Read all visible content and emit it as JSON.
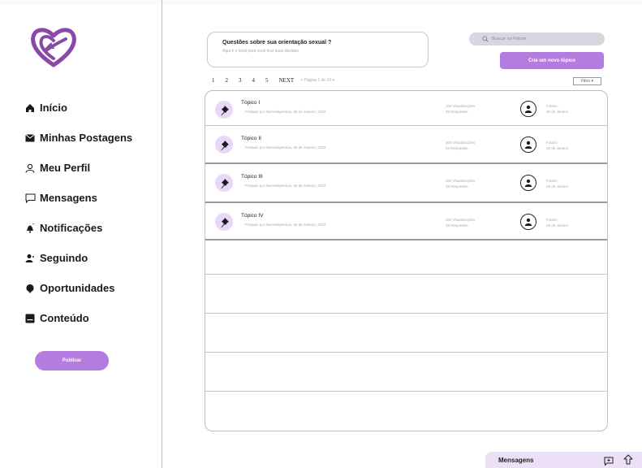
{
  "sidebar": {
    "nav": [
      {
        "label": "Início",
        "icon": "home-icon"
      },
      {
        "label": "Minhas Postagens",
        "icon": "mail-icon"
      },
      {
        "label": "Meu Perfil",
        "icon": "user-icon"
      },
      {
        "label": "Mensagens",
        "icon": "chat-icon"
      },
      {
        "label": "Notificações",
        "icon": "bell-icon"
      },
      {
        "label": "Seguindo",
        "icon": "following-icon"
      },
      {
        "label": "Oportunidades",
        "icon": "opportunity-icon"
      },
      {
        "label": "Conteúdo",
        "icon": "content-icon"
      }
    ],
    "publish_label": "Publicar"
  },
  "forum": {
    "question_title": "Questões sobre sua orientação sexual ?",
    "question_subtitle": "Aqui é o local para você tirar suas dúvidas",
    "search_placeholder": "Buscar no Fórum",
    "create_label": "Crie um novo tópico",
    "pages": [
      "1",
      "2",
      "3",
      "4",
      "5"
    ],
    "next_label": "NEXT",
    "page_info": "> Página 1 de 10 ▾",
    "filter_label": "Filtro ▾"
  },
  "topics": [
    {
      "title": "Tópico I",
      "meta": "Postado por Nomedapessoa, 26 de Janeiro, 2022",
      "views": "100 Visualizações",
      "replies": "20 Respostas",
      "user": "Fulano",
      "date": "30 de Janeiro"
    },
    {
      "title": "Tópico II",
      "meta": "Postado por Nomedapessoa, 26 de Janeiro, 2022",
      "views": "300 Visualizações",
      "replies": "28 Respostas",
      "user": "Fulano",
      "date": "28 de Janeiro"
    },
    {
      "title": "Tópico III",
      "meta": "Postado por Nomedapessoa, 26 de Janeiro, 2022",
      "views": "300 Visualizações",
      "replies": "28 Respostas",
      "user": "Fulano",
      "date": "28 de Janeiro"
    },
    {
      "title": "Tópico IV",
      "meta": "Postado por Nomedapessoa, 26 de Janeiro, 2022",
      "views": "300 Visualizações",
      "replies": "28 Respostas",
      "user": "Fulano",
      "date": "28 de Janeiro"
    }
  ],
  "messages_bar": {
    "label": "Mensagens"
  },
  "colors": {
    "accent": "#b57ce0",
    "logo": "#8a49a8",
    "search_bg": "#d9d6df",
    "msgbar_bg": "#ece0f6"
  }
}
